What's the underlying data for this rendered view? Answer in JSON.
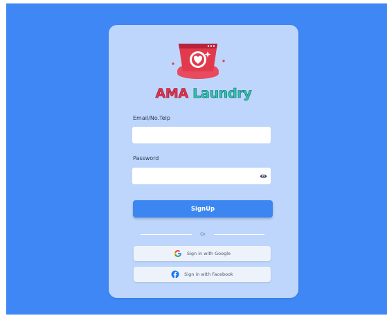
{
  "brand": {
    "word1": "AMA",
    "word2": "Laundry",
    "colors": {
      "word1": "#e2334c",
      "word2": "#2ec6a6"
    },
    "logo_icon": "laundry-heart-logo"
  },
  "form": {
    "email_label": "Email/No.Telp",
    "email_value": "",
    "password_label": "Password",
    "password_value": "",
    "toggle_visibility_icon": "eye-icon"
  },
  "actions": {
    "signup_label": "SignUp",
    "divider_text": "Or",
    "google_label": "Sign in with Google",
    "facebook_label": "Sign in with Facebook"
  },
  "colors": {
    "background": "#3f87f4",
    "card": "#bed6fb",
    "primary": "#3c86f2"
  }
}
